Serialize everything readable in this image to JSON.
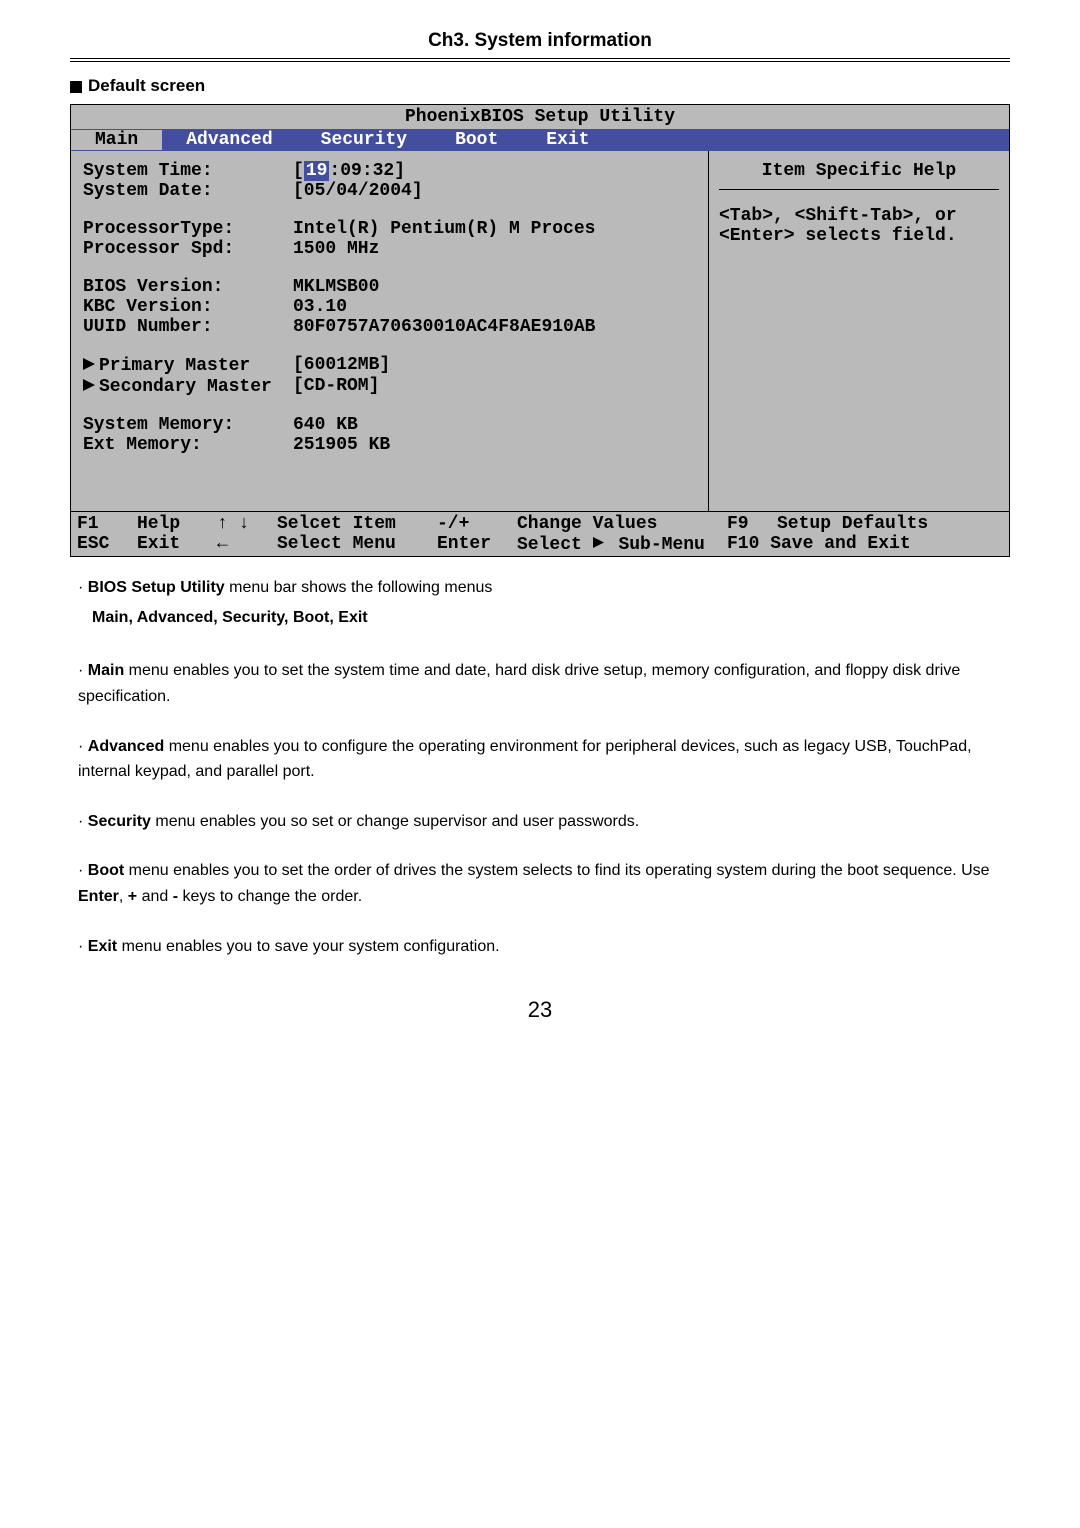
{
  "chapter_title": "Ch3. System information",
  "section_title": "Default screen",
  "bios": {
    "title": "PhoenixBIOS Setup Utility",
    "tabs": [
      "Main",
      "Advanced",
      "Security",
      "Boot",
      "Exit"
    ],
    "help_header": "Item Specific Help",
    "help_body1": "<Tab>, <Shift-Tab>, or",
    "help_body2": "<Enter> selects field.",
    "fields": {
      "system_time_k": "System Time:",
      "system_time_v1": "19",
      "system_time_v2": ":09:32]",
      "system_date_k": "System Date:",
      "system_date_v": "[05/04/2004]",
      "proc_type_k": "ProcessorType:",
      "proc_type_v": "Intel(R) Pentium(R) M Proces",
      "proc_spd_k": "Processor Spd:",
      "proc_spd_v": "1500 MHz",
      "bios_ver_k": "BIOS Version:",
      "bios_ver_v": "MKLMSB00",
      "kbc_ver_k": "KBC Version:",
      "kbc_ver_v": "03.10",
      "uuid_k": "UUID Number:",
      "uuid_v": "80F0757A70630010AC4F8AE910AB",
      "pri_k": "Primary Master",
      "pri_v": "[60012MB]",
      "sec_k": "Secondary Master",
      "sec_v": "[CD-ROM]",
      "sysmem_k": "System Memory:",
      "sysmem_v": "640 KB",
      "extmem_k": "Ext Memory:",
      "extmem_v": "251905 KB"
    },
    "footer": {
      "f1": "F1",
      "help": "Help",
      "arrows": "↑ ↓",
      "sel_item": "Selcet Item",
      "pm": "-/+",
      "chg": "Change Values",
      "f9": "F9",
      "setup_def": "Setup Defaults",
      "esc": "ESC",
      "exit": "Exit",
      "left": "←",
      "sel_menu": "Select Menu",
      "enter": "Enter",
      "sel_sub": "Select ",
      "sub_menu": "Sub-Menu",
      "f10": "F10 Save and Exit"
    }
  },
  "doc": {
    "p1a": "· ",
    "p1b": "BIOS Setup Utility",
    "p1c": " menu bar shows the following menus",
    "p2": "Main, Advanced, Security, Boot, Exit",
    "p3a": "· ",
    "p3b": "Main",
    "p3c": " menu enables you to set the system time and date, hard disk drive setup, memory configuration, and floppy disk drive specification.",
    "p4a": "· ",
    "p4b": "Advanced",
    "p4c": " menu enables you to configure the operating environment for peripheral devices, such as legacy USB,  TouchPad, internal keypad, and parallel port.",
    "p5a": "· ",
    "p5b": "Security",
    "p5c": " menu enables you so set or change supervisor and  user passwords.",
    "p6a": "· ",
    "p6b": "Boot",
    "p6c": " menu enables you to set the order of drives the system selects to find its operating system during the boot sequence. Use ",
    "p6d": "Enter",
    "p6e": ", ",
    "p6f": "+",
    "p6g": " and ",
    "p6h": "-",
    "p6i": " keys to change  the order.",
    "p7a": "· ",
    "p7b": "Exit",
    "p7c": " menu enables you to save your system configuration."
  },
  "page_number": "23"
}
